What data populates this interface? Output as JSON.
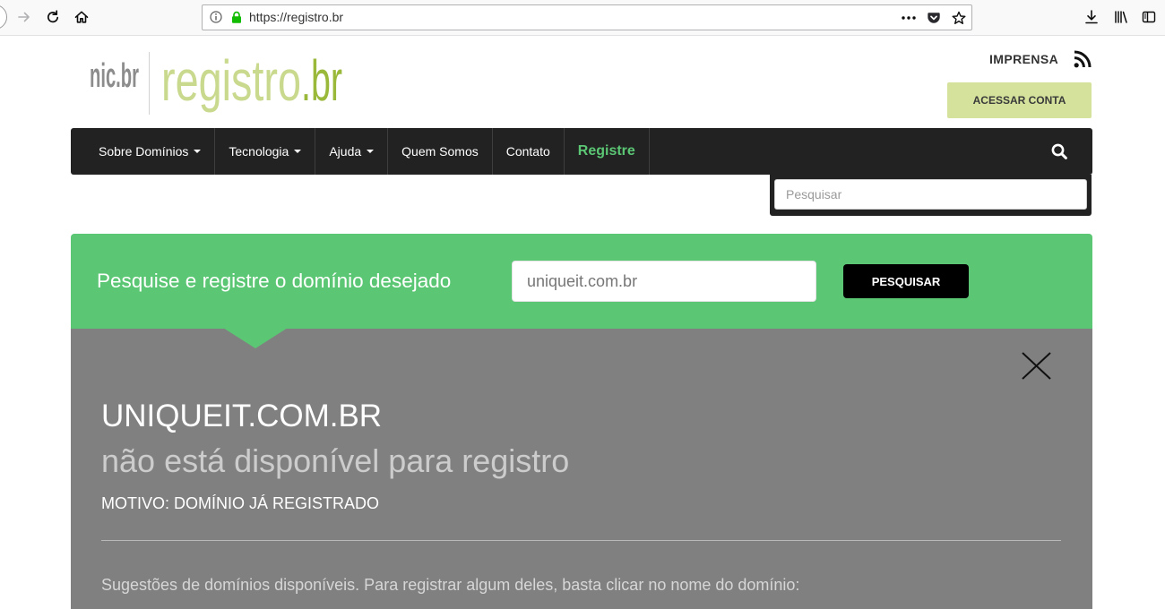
{
  "browser": {
    "url": "https://registro.br",
    "toolbar_icons": [
      "back-icon",
      "forward-icon",
      "reload-icon",
      "home-icon",
      "info-icon",
      "lock-icon",
      "page-actions-icon",
      "pocket-icon",
      "bookmark-star-icon",
      "downloads-icon",
      "library-icon",
      "sidebar-icon"
    ]
  },
  "header": {
    "logo": {
      "nic": "nic.br",
      "registro": "registro",
      "br": ".br"
    },
    "imprensa_link": "IMPRENSA",
    "rss_icon": "rss-icon",
    "account_button": "ACESSAR CONTA"
  },
  "nav": {
    "items": [
      {
        "label": "Sobre Domínios",
        "has_dropdown": true
      },
      {
        "label": "Tecnologia",
        "has_dropdown": true
      },
      {
        "label": "Ajuda",
        "has_dropdown": true
      },
      {
        "label": "Quem Somos",
        "has_dropdown": false
      },
      {
        "label": "Contato",
        "has_dropdown": false
      },
      {
        "label": "Registre",
        "has_dropdown": false,
        "highlighted": true
      }
    ],
    "search_icon": "search-icon",
    "search_placeholder": "Pesquisar"
  },
  "domain_search": {
    "heading": "Pesquise e registre o domínio desejado",
    "input_value": "uniqueit.com.br",
    "button_label": "PESQUISAR"
  },
  "result": {
    "domain": "UNIQUEIT.COM.BR",
    "status": "não está disponível para registro",
    "reason": "MOTIVO: DOMÍNIO JÁ REGISTRADO",
    "suggestions_intro": "Sugestões de domínios disponíveis. Para registrar algum deles, basta clicar no nome do domínio:",
    "close_icon": "close-icon"
  },
  "colors": {
    "brand_green": "#5bc674",
    "logo_light_green": "#c9d98d",
    "logo_dark_green": "#9ab93b",
    "account_button_bg": "#d4e29c",
    "nav_bg": "#222222",
    "result_panel_bg": "#808080"
  }
}
